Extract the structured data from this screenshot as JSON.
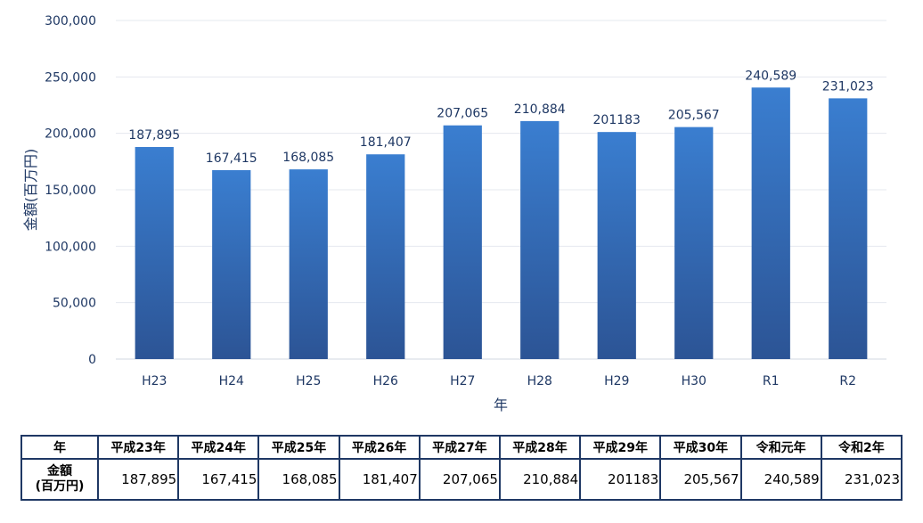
{
  "chart_data": {
    "type": "bar",
    "categories": [
      "H23",
      "H24",
      "H25",
      "H26",
      "H27",
      "H28",
      "H29",
      "H30",
      "R1",
      "R2"
    ],
    "values": [
      187895,
      167415,
      168085,
      181407,
      207065,
      210884,
      201183,
      205567,
      240589,
      231023
    ],
    "data_labels": [
      "187,895",
      "167,415",
      "168,085",
      "181,407",
      "207,065",
      "210,884",
      "201183",
      "205,567",
      "240,589",
      "231,023"
    ],
    "ylabel": "金額(百万円)",
    "xlabel": "年",
    "ylim": [
      0,
      300000
    ],
    "yticks": [
      0,
      50000,
      100000,
      150000,
      200000,
      250000,
      300000
    ],
    "ytick_labels": [
      "0",
      "50,000",
      "100,000",
      "150,000",
      "200,000",
      "250,000",
      "300,000"
    ],
    "grid": true,
    "bar_color_top": "#3a7ed0",
    "bar_color_bottom": "#2c5495"
  },
  "table": {
    "header_label": "年",
    "years": [
      "平成23年",
      "平成24年",
      "平成25年",
      "平成26年",
      "平成27年",
      "平成28年",
      "平成29年",
      "平成30年",
      "令和元年",
      "令和2年"
    ],
    "row_label_line1": "金額",
    "row_label_line2": "(百万円)",
    "values": [
      "187,895",
      "167,415",
      "168,085",
      "181,407",
      "207,065",
      "210,884",
      "201183",
      "205,567",
      "240,589",
      "231,023"
    ]
  }
}
